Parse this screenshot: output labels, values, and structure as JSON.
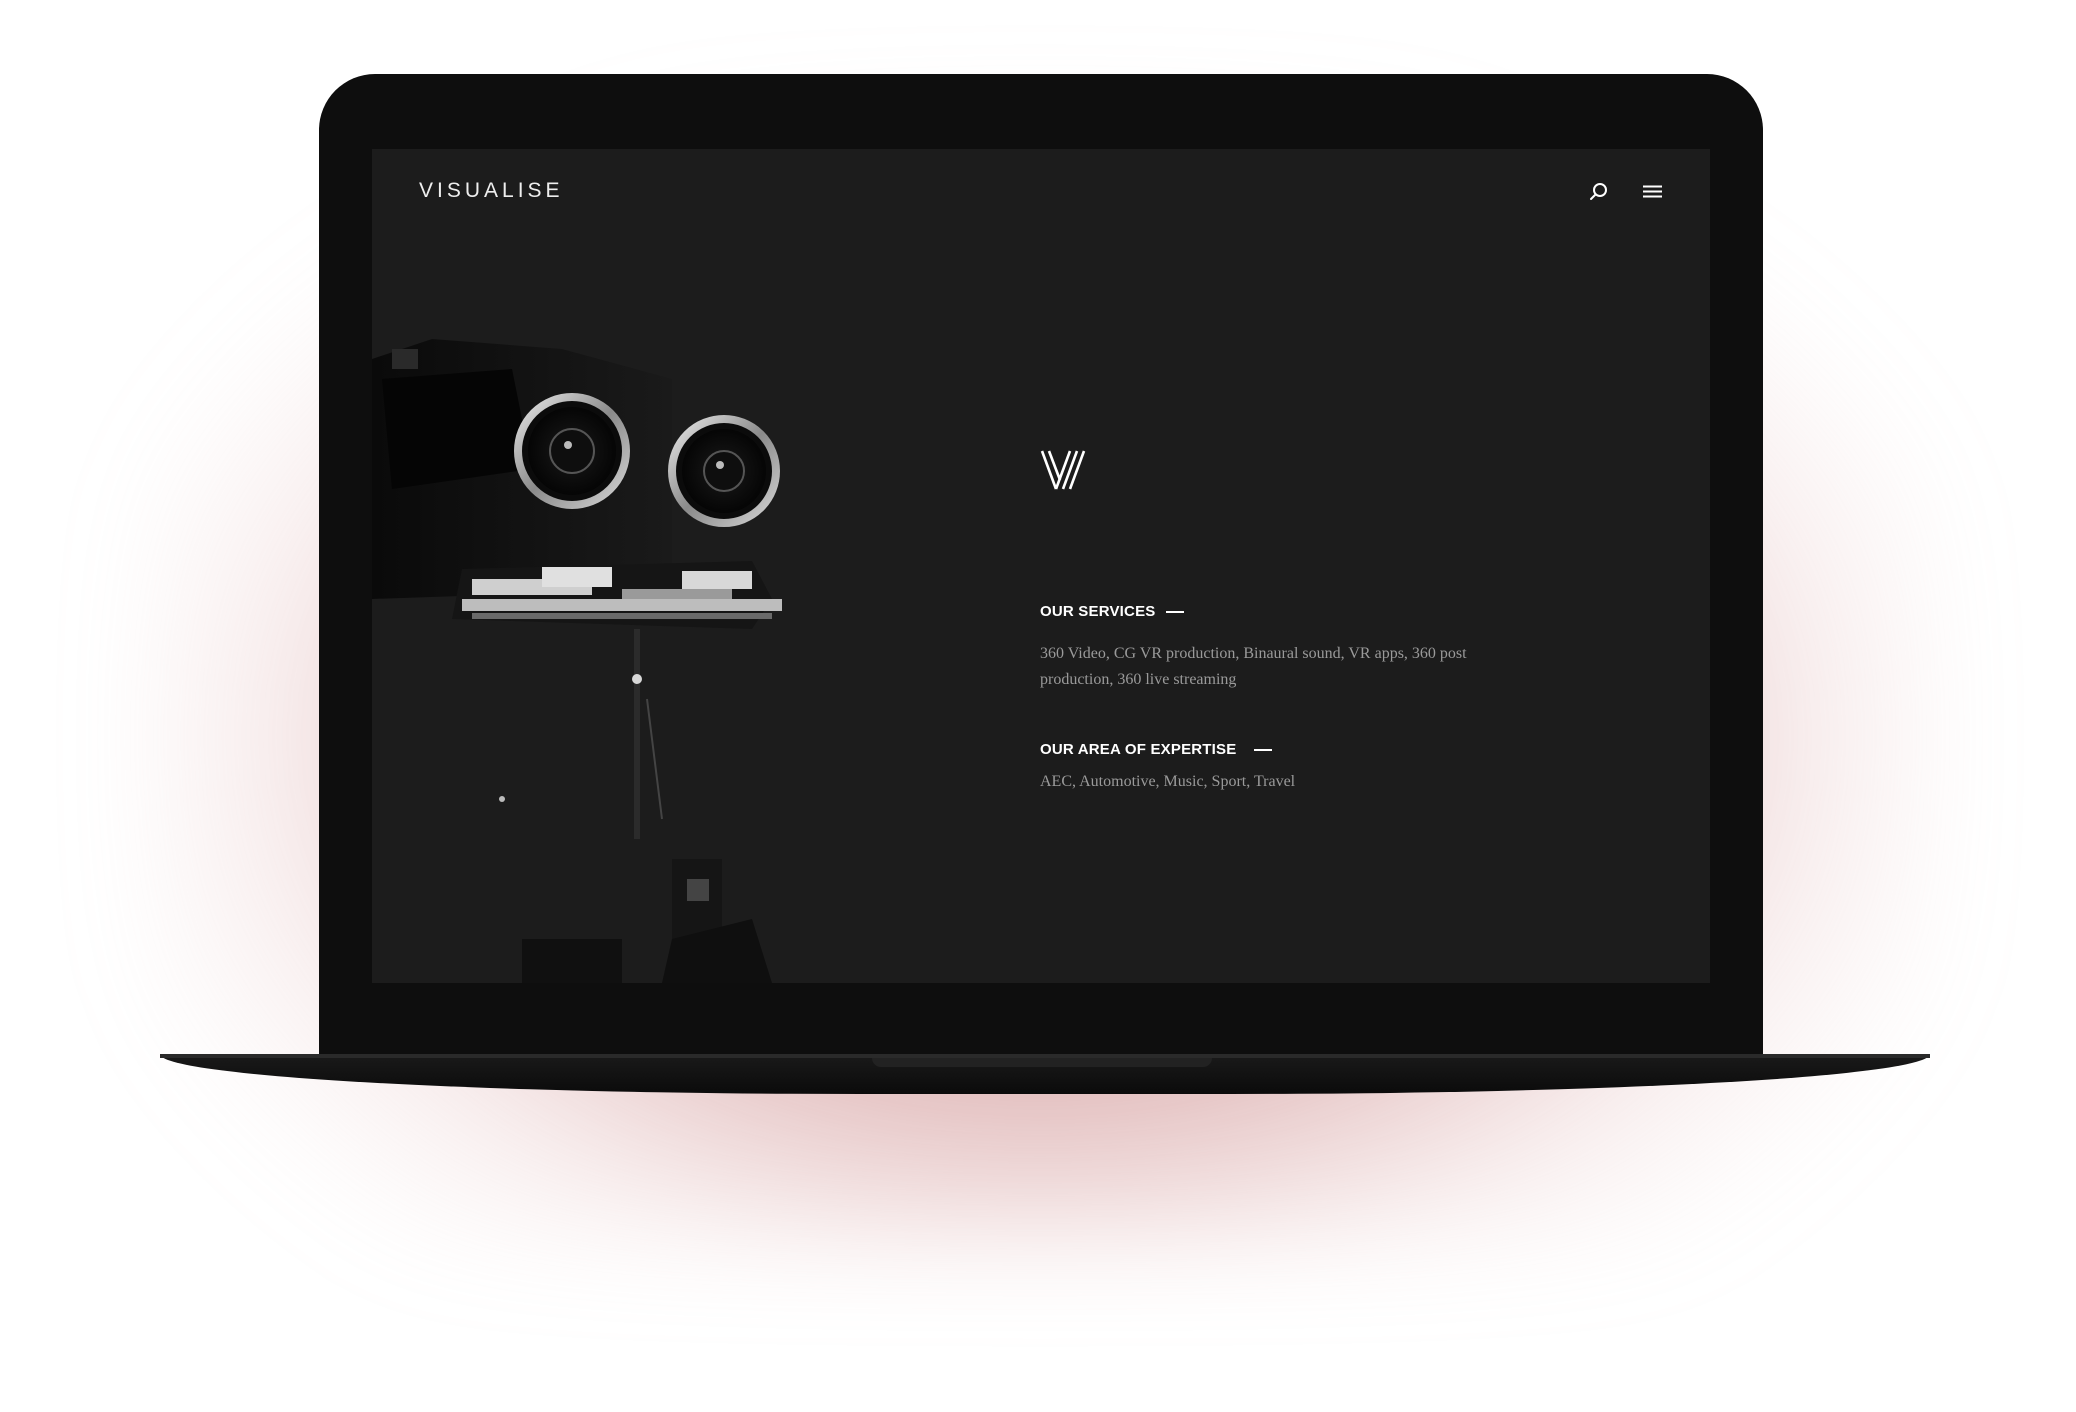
{
  "site": {
    "brand": "VISUALISE"
  },
  "header": {
    "icons": [
      "search-icon",
      "hamburger-menu-icon"
    ]
  },
  "hero": {
    "image_subject": "stereo-vr-camera-rig",
    "logo_icon": "visualise-w-logo-icon"
  },
  "sections": {
    "services": {
      "heading": "OUR SERVICES",
      "body": "360 Video, CG VR production, Binaural sound, VR apps, 360 post production, 360 live streaming"
    },
    "expertise": {
      "heading": "OUR AREA OF EXPERTISE",
      "body": "AEC, Automotive, Music, Sport, Travel"
    }
  },
  "colors": {
    "screen_background": "#1c1c1c",
    "heading_text": "#ffffff",
    "body_text": "#9a9a9a",
    "shadow_glow": "#a53737"
  }
}
